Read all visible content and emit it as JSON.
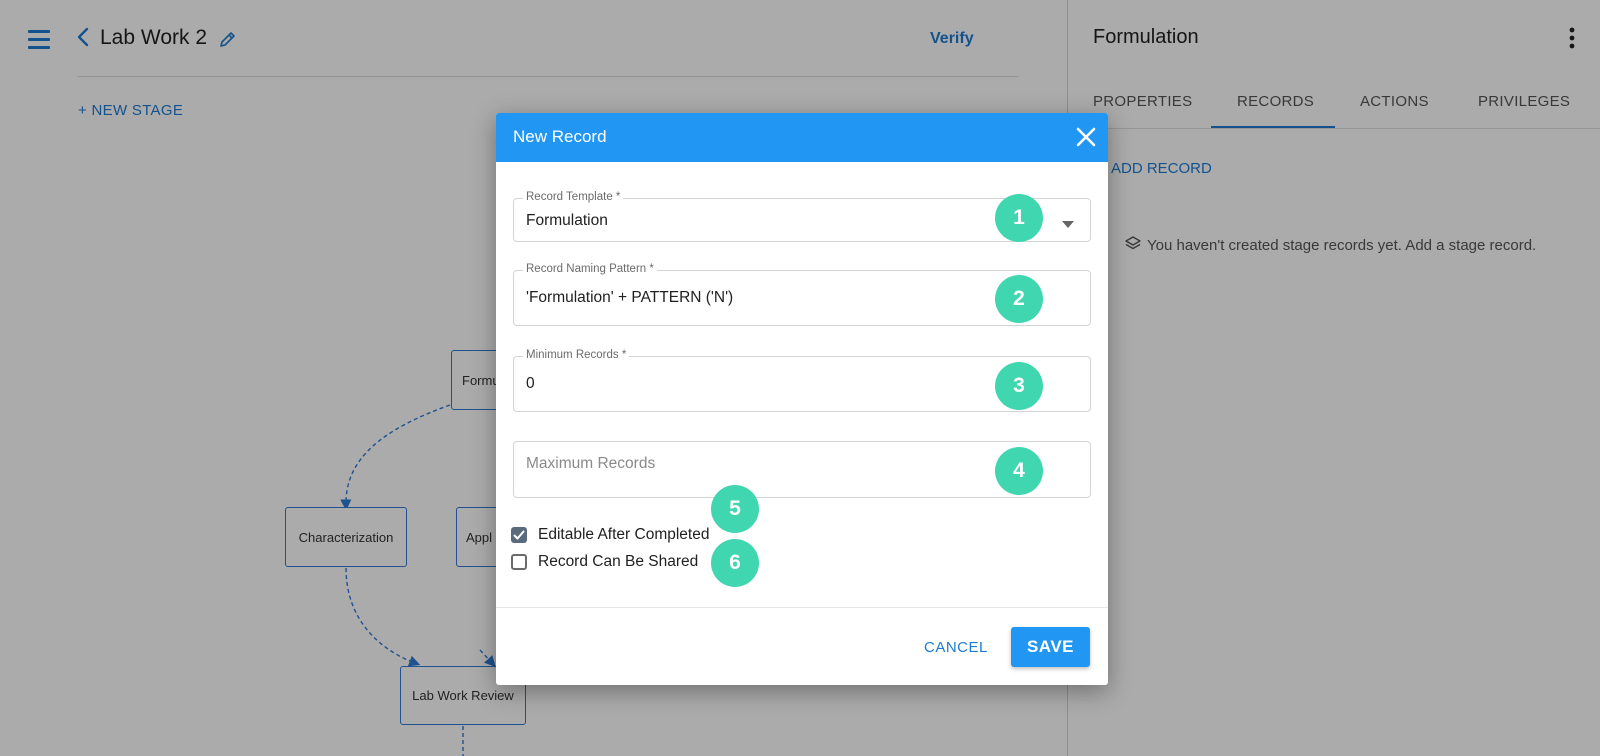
{
  "header": {
    "title": "Lab Work 2",
    "verify_label": "Verify",
    "new_stage_label": "+ NEW STAGE"
  },
  "workflow": {
    "nodes": [
      "Formu",
      "Characterization",
      "Appl",
      "Lab Work Review"
    ]
  },
  "right_panel": {
    "title": "Formulation",
    "tabs": [
      "PROPERTIES",
      "RECORDS",
      "ACTIONS",
      "PRIVILEGES"
    ],
    "active_tab": "RECORDS",
    "add_record_label": "ADD RECORD",
    "empty_message": "You haven't created stage records yet. Add a stage record."
  },
  "dialog": {
    "title": "New Record",
    "fields": {
      "template": {
        "label": "Record Template *",
        "value": "Formulation"
      },
      "naming": {
        "label": "Record Naming Pattern *",
        "value": "'Formulation' + PATTERN ('N')"
      },
      "min": {
        "label": "Minimum Records *",
        "value": "0"
      },
      "max": {
        "placeholder": "Maximum Records"
      }
    },
    "checkboxes": [
      {
        "label": "Editable After Completed",
        "checked": true
      },
      {
        "label": "Record Can Be Shared",
        "checked": false
      }
    ],
    "cancel_label": "CANCEL",
    "save_label": "SAVE"
  },
  "badges": [
    "1",
    "2",
    "3",
    "4",
    "5",
    "6"
  ],
  "colors": {
    "primary": "#2196f3",
    "link": "#1e7bd2",
    "badge": "#3fd6b0",
    "node_border": "#2f7bd6"
  }
}
